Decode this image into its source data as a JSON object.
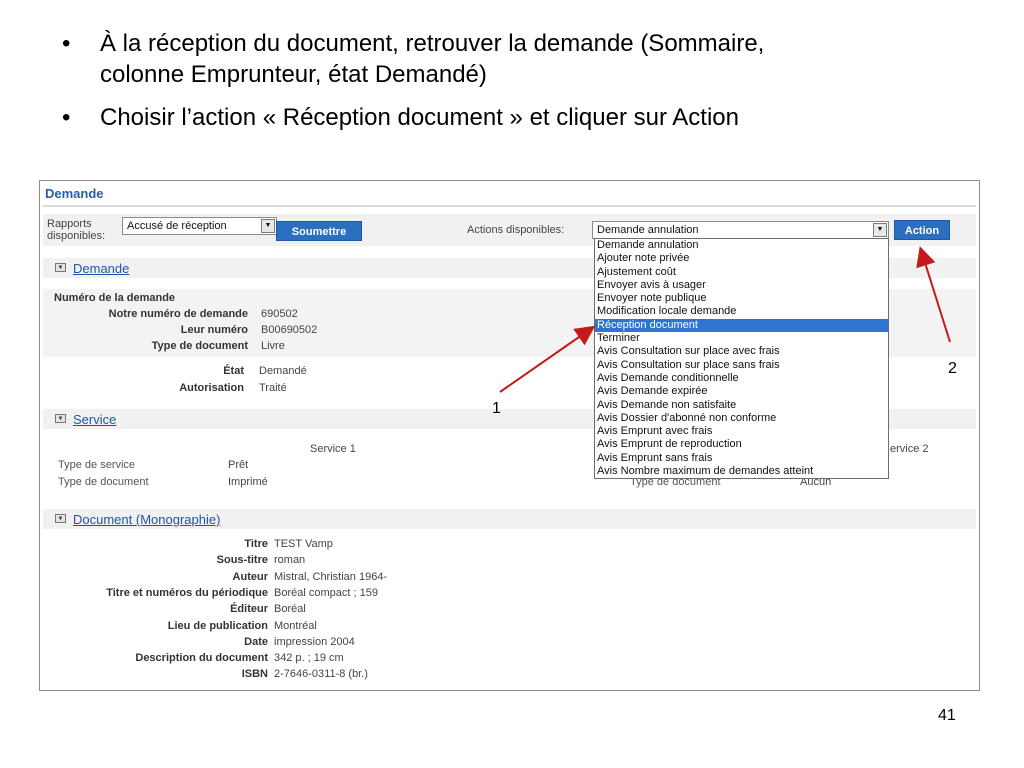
{
  "slide": {
    "bullets": [
      {
        "line1": "À la réception du document, retrouver la demande (Sommaire,",
        "line2": "colonne Emprunteur, état Demandé)"
      },
      {
        "line1": "Choisir l’action « Réception document » et cliquer sur Action",
        "line2": ""
      }
    ],
    "bullet_char": "•",
    "page_number": "41",
    "callout_1": "1",
    "callout_2": "2"
  },
  "panel": {
    "title": "Demande",
    "toolbar": {
      "reports_label_1": "Rapports",
      "reports_label_2": "disponibles:",
      "reports_selected": "Accusé de réception",
      "submit_label": "Soumettre",
      "actions_label": "Actions disponibles:",
      "actions_selected": "Demande annulation",
      "action_button": "Action"
    },
    "actions_options": [
      "Demande annulation",
      "Ajouter note privée",
      "Ajustement coût",
      "Envoyer avis à usager",
      "Envoyer note publique",
      "Modification locale demande",
      "Réception document",
      "Terminer",
      "Avis Consultation sur place avec frais",
      "Avis Consultation sur place sans frais",
      "Avis Demande conditionnelle",
      "Avis Demande expirée",
      "Avis Demande non satisfaite",
      "Avis Dossier d'abonné non conforme",
      "Avis Emprunt avec frais",
      "Avis Emprunt de reproduction",
      "Avis Emprunt sans frais",
      "Avis Nombre maximum de demandes atteint"
    ],
    "demande": {
      "section_title": "Demande",
      "heading": "Numéro de la demande",
      "notre_numero_label": "Notre numéro de demande",
      "notre_numero": "690502",
      "leur_numero_label": "Leur numéro",
      "leur_numero": "B00690502",
      "type_doc_label": "Type de document",
      "type_doc": "Livre",
      "etat_label": "État",
      "etat": "Demandé",
      "autorisation_label": "Autorisation",
      "autorisation": "Traité"
    },
    "service": {
      "section_title": "Service",
      "service1_heading": "Service 1",
      "service2_heading": "ervice 2",
      "type_service_label": "Type de service",
      "type_service": "Prêt",
      "type_doc_label": "Type de document",
      "type_doc": "Imprimé",
      "type_doc2_label": "Type de document",
      "type_doc2": "Aucun"
    },
    "document": {
      "section_title": "Document (Monographie)",
      "fields": [
        {
          "label": "Titre",
          "value": "TEST Vamp"
        },
        {
          "label": "Sous-titre",
          "value": "roman"
        },
        {
          "label": "Auteur",
          "value": "Mistral, Christian 1964-"
        },
        {
          "label": "Titre et numéros du périodique",
          "value": "Boréal compact ; 159"
        },
        {
          "label": "Éditeur",
          "value": "Boréal"
        },
        {
          "label": "Lieu de publication",
          "value": "Montréal"
        },
        {
          "label": "Date",
          "value": "impression 2004"
        },
        {
          "label": "Description du document",
          "value": "342 p. ; 19 cm"
        },
        {
          "label": "ISBN",
          "value": "2-7646-0311-8 (br.)"
        }
      ]
    }
  },
  "colors": {
    "accent_blue": "#2b6fc0",
    "link_blue": "#1e56a8",
    "selected_item": "#2f74d0",
    "arrow_red": "#c41a1a"
  }
}
